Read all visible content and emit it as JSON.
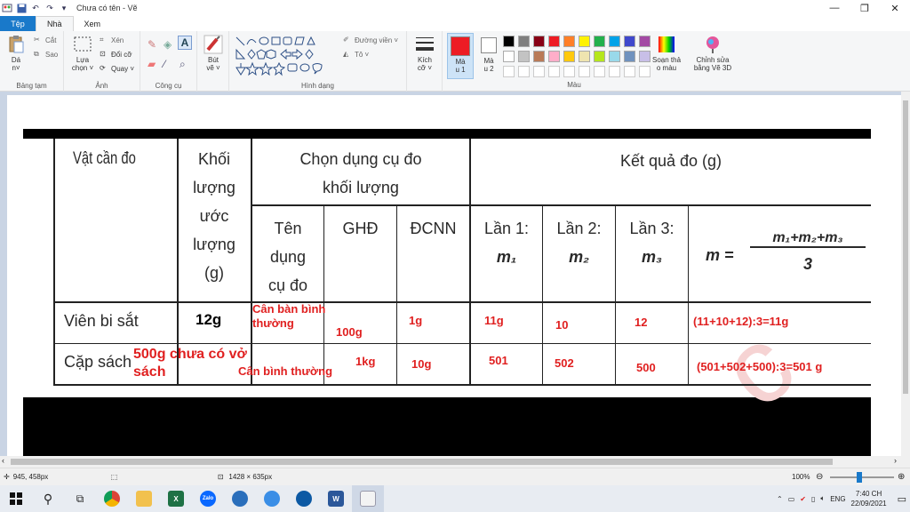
{
  "window": {
    "title": "Chưa có tên - Vẽ",
    "minimize_icon": "minimize-icon",
    "maximize_icon": "maximize-icon",
    "close_icon": "close-icon",
    "min_glyph": "—",
    "max_glyph": "❐",
    "close_glyph": "✕"
  },
  "tabs": [
    "Tệp",
    "Nhà",
    "Xem"
  ],
  "ribbon": {
    "clipboard": {
      "paste": "Dá n˅",
      "cut": "Cắt",
      "copy": "Sao",
      "label": "Bảng tạm"
    },
    "image": {
      "select": "Lựa chọn ˅",
      "crop": "Xén",
      "resize": "Đổi cỡ",
      "rotate": "Quay ˅",
      "label": "Ảnh"
    },
    "tools": {
      "label": "Công cụ"
    },
    "brushes": {
      "label": "Bút vẽ ˅"
    },
    "shapes": {
      "outline": "Đường viền ˅",
      "fill": "Tô ˅",
      "label": "Hình dạng"
    },
    "size": {
      "label": "Kích cỡ ˅"
    },
    "color1": {
      "label": "Mà u 1"
    },
    "color2": {
      "label": "Mà u 2"
    },
    "colors": {
      "label": "Màu",
      "palette_row1": [
        "#000000",
        "#7f7f7f",
        "#880015",
        "#ed1c24",
        "#ff7f27",
        "#fff200",
        "#22b14c",
        "#00a2e8",
        "#3f48cc",
        "#a349a4"
      ],
      "palette_row2": [
        "#ffffff",
        "#c3c3c3",
        "#b97a57",
        "#ffaec9",
        "#ffc90e",
        "#efe4b0",
        "#b5e61d",
        "#99d9ea",
        "#7092be",
        "#c8bfe7"
      ]
    },
    "edit_colors": "Soạn thả o màu",
    "paint3d": "Chỉnh sửa bằng Vẽ 3D",
    "accent_color1": "#ed1c24"
  },
  "table": {
    "headers": {
      "object": "Vật cần đo",
      "estimated_mass": [
        "Khối",
        "lượng",
        "ước",
        "lượng",
        "(g)"
      ],
      "choose_tool": [
        "Chọn dụng cụ đo",
        "khối lượng"
      ],
      "result": "Kết quả đo (g)",
      "tool_name": [
        "Tên",
        "dụng",
        "cụ đo"
      ],
      "ghd": "GHĐ",
      "dcnn": "ĐCNN",
      "lan1": [
        "Lần 1:",
        "m₁"
      ],
      "lan2": [
        "Lần 2:",
        "m₂"
      ],
      "lan3": [
        "Lần 3:",
        "m₃"
      ],
      "formula_lhs": "m =",
      "formula_num": "m₁+m₂+m₃",
      "formula_den": "3"
    },
    "rows": [
      {
        "object": "Viên bi sắt",
        "estimate": "12g",
        "tool": [
          "Cân bàn bình",
          "thường"
        ],
        "ghd": "100g",
        "dcnn": "1g",
        "m1": "11g",
        "m2": "10",
        "m3": "12",
        "m": "(11+10+12):3=11g"
      },
      {
        "object": "Cặp sách",
        "estimate": [
          "500g chưa có vở",
          "sách"
        ],
        "tool": "Cân bình thường",
        "ghd": "1kg",
        "dcnn": "10g",
        "m1": "501",
        "m2": "502",
        "m3": "500",
        "m": "(501+502+500):3=501 g"
      }
    ]
  },
  "status": {
    "cursor": "945, 458px",
    "size": "1428 × 635px",
    "zoom": "100%"
  },
  "taskbar": {
    "lang": "ENG",
    "time": "7:40 CH",
    "date": "22/09/2021"
  }
}
